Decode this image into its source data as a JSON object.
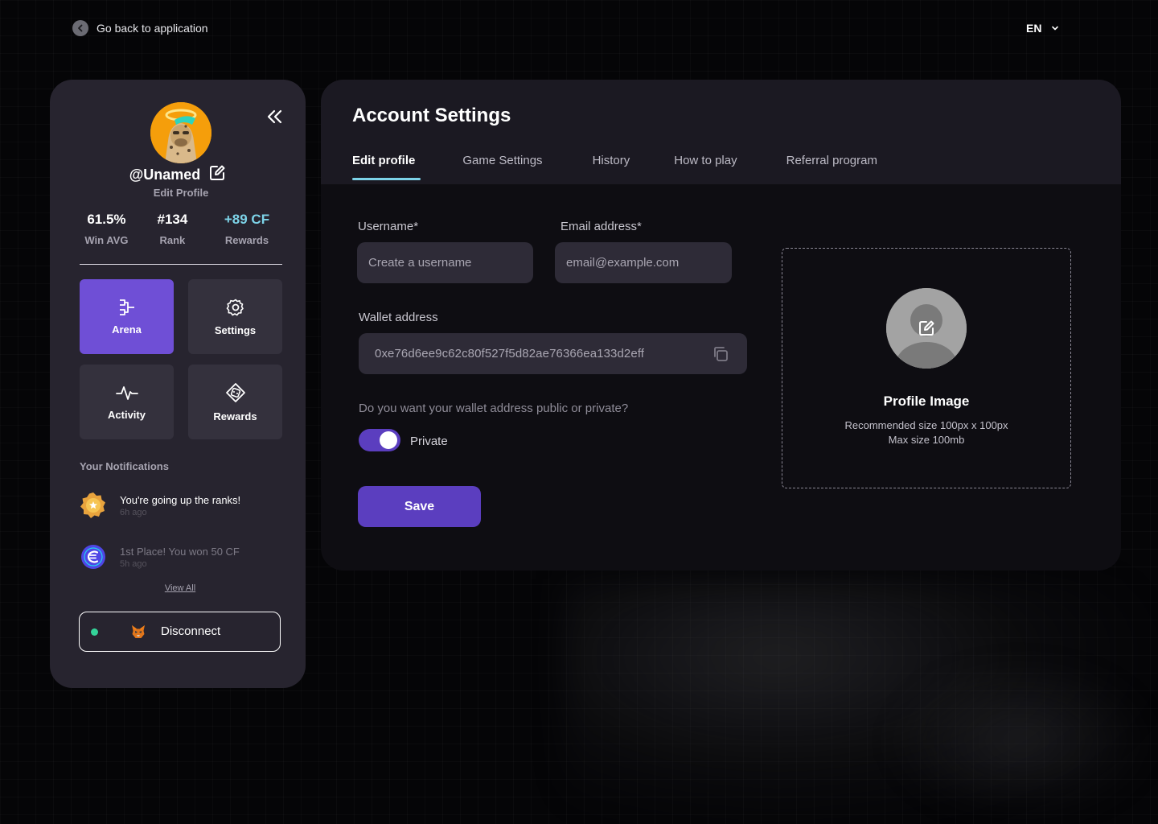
{
  "top": {
    "back_label": "Go back to application",
    "language": "EN"
  },
  "sidebar": {
    "username": "@Unamed",
    "edit_profile": "Edit Profile",
    "stats": [
      {
        "value": "61.5%",
        "label": "Win AVG"
      },
      {
        "value": "#134",
        "label": "Rank"
      },
      {
        "value": "+89 CF",
        "label": "Rewards"
      }
    ],
    "tiles": [
      {
        "label": "Arena",
        "icon": "arena-icon",
        "active": true
      },
      {
        "label": "Settings",
        "icon": "gear-icon",
        "active": false
      },
      {
        "label": "Activity",
        "icon": "activity-icon",
        "active": false
      },
      {
        "label": "Rewards",
        "icon": "rewards-icon",
        "active": false
      }
    ],
    "notifications_heading": "Your Notifications",
    "notifications": [
      {
        "title": "You're going up the ranks!",
        "time": "6h ago",
        "icon": "rank-badge-icon"
      },
      {
        "title": "1st Place! You won 50 CF",
        "time": "5h ago",
        "icon": "coin-icon"
      }
    ],
    "view_all": "View All",
    "disconnect_label": "Disconnect"
  },
  "main": {
    "title": "Account Settings",
    "tabs": [
      {
        "label": "Edit profile",
        "active": true
      },
      {
        "label": "Game Settings",
        "active": false
      },
      {
        "label": "History",
        "active": false
      },
      {
        "label": "How to play",
        "active": false
      },
      {
        "label": "Referral program",
        "active": false
      }
    ],
    "form": {
      "username_label": "Username*",
      "username_placeholder": "Create a username",
      "email_label": "Email address*",
      "email_placeholder": "email@example.com",
      "wallet_label": "Wallet address",
      "wallet_value": "0xe76d6ee9c62c80f527f5d82ae76366ea133d2eff",
      "privacy_question": "Do you want your wallet address public or private?",
      "privacy_toggle_label": "Private",
      "privacy_toggle_on": true,
      "save_label": "Save"
    },
    "profile_image": {
      "title": "Profile Image",
      "recommended": "Recommended size 100px x 100px",
      "max_size": "Max size 100mb"
    }
  },
  "colors": {
    "accent_purple": "#6f4fd6",
    "button_purple": "#5b3ebf",
    "accent_cyan": "#7dd3e8",
    "online_green": "#34d399"
  }
}
